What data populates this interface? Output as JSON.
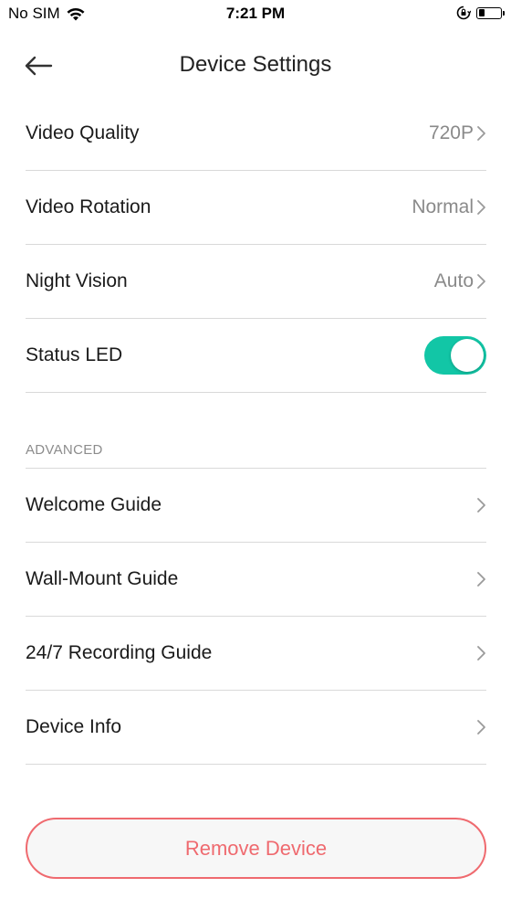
{
  "status_bar": {
    "carrier": "No SIM",
    "time": "7:21 PM",
    "battery_level": 0.25
  },
  "header": {
    "title": "Device Settings",
    "back_icon": "arrow-left-icon"
  },
  "settings": [
    {
      "label": "Video Quality",
      "value": "720P"
    },
    {
      "label": "Video Rotation",
      "value": "Normal"
    },
    {
      "label": "Night Vision",
      "value": "Auto"
    }
  ],
  "status_led": {
    "label": "Status LED",
    "enabled": true,
    "toggle_color": "#12c6a6"
  },
  "advanced": {
    "section_label": "ADVANCED",
    "items": [
      {
        "label": "Welcome Guide"
      },
      {
        "label": "Wall-Mount Guide"
      },
      {
        "label": "24/7 Recording Guide"
      },
      {
        "label": "Device Info"
      }
    ]
  },
  "remove_button": {
    "label": "Remove Device",
    "color": "#ef6a6f"
  }
}
